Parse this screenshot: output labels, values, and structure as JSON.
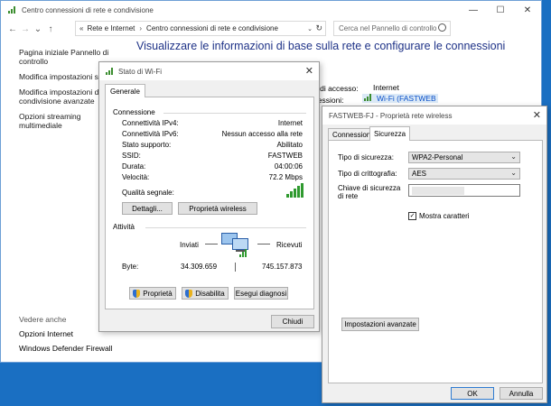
{
  "main_window": {
    "title": "Centro connessioni di rete e condivisione",
    "controls": {
      "minimize": "—",
      "maximize": "☐",
      "close": "✕"
    },
    "nav": {
      "back": "←",
      "forward": "→",
      "dropdown": "⌄",
      "up": "↑"
    },
    "address": {
      "home_glyph": "«",
      "crumb_1": "Rete e Internet",
      "separator": "›",
      "crumb_2": "Centro connessioni di rete e condivisione",
      "dropdown": "⌄",
      "refresh": "↻"
    },
    "search_placeholder": "Cerca nel Pannello di controllo",
    "heading": "Visualizzare le informazioni di base sulla rete e configurare le connessioni",
    "sidebar": [
      "Pagina iniziale Pannello di controllo",
      "Modifica impostazioni sch",
      "Modifica impostazioni di condivisione avanzate",
      "Opzioni streaming multimediale"
    ],
    "see_also": {
      "title": "Vedere anche",
      "items": [
        "Opzioni Internet",
        "Windows Defender Firewall"
      ]
    },
    "bg_info": {
      "access_label": "o di accesso:",
      "access_value": "Internet",
      "connections_label": "nessioni:",
      "connection_value": "Wi-Fi (FASTWEB"
    }
  },
  "status_dialog": {
    "title": "Stato di Wi-Fi",
    "close": "✕",
    "tab": "Generale",
    "connection_group": "Connessione",
    "rows": [
      {
        "label": "Connettività IPv4:",
        "value": "Internet"
      },
      {
        "label": "Connettività IPv6:",
        "value": "Nessun accesso alla rete"
      },
      {
        "label": "Stato supporto:",
        "value": "Abilitato"
      },
      {
        "label": "SSID:",
        "value": "FASTWEB"
      },
      {
        "label": "Durata:",
        "value": "04:00:06"
      },
      {
        "label": "Velocità:",
        "value": "72.2 Mbps"
      }
    ],
    "signal_label": "Qualità segnale:",
    "details_button": "Dettagli...",
    "wireless_props_button": "Proprietà wireless",
    "activity_group": "Attività",
    "sent_label": "Inviati",
    "received_label": "Ricevuti",
    "bytes_label": "Byte:",
    "bytes_sent": "34.309.659",
    "bytes_received": "745.157.873",
    "properties_button": "Proprietà",
    "disable_button": "Disabilita",
    "diagnose_button": "Esegui diagnosi",
    "close_button": "Chiudi"
  },
  "props_dialog": {
    "title": "FASTWEB-FJ - Proprietà rete wireless",
    "close": "✕",
    "tab_connection": "Connessione",
    "tab_security": "Sicurezza",
    "security_type_label": "Tipo di sicurezza:",
    "security_type_value": "WPA2-Personal",
    "encryption_type_label": "Tipo di crittografia:",
    "encryption_type_value": "AES",
    "key_label": "Chiave di sicurezza di rete",
    "show_chars_label": "Mostra caratteri",
    "show_chars_mark": "✓",
    "advanced_button": "Impostazioni avanzate",
    "ok_button": "OK",
    "cancel_button": "Annulla"
  }
}
